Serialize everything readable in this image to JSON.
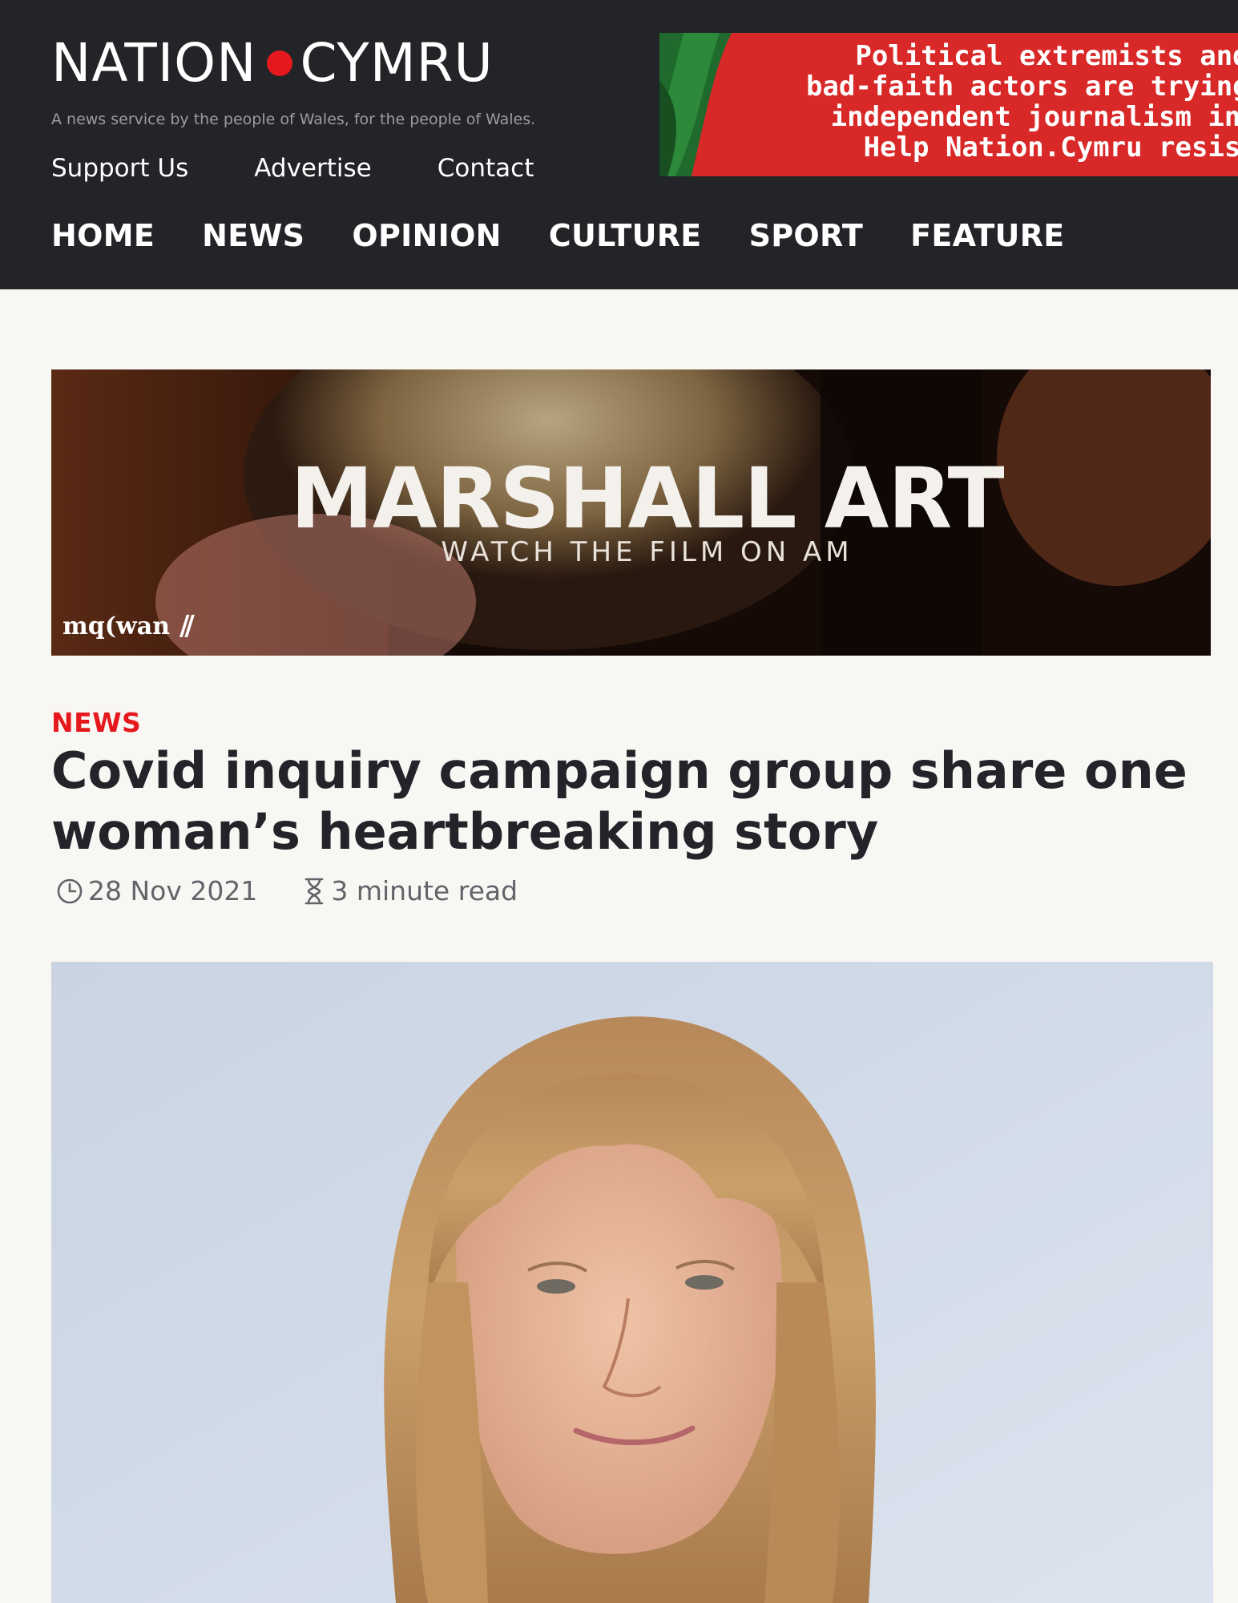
{
  "header": {
    "logo_left": "NATION",
    "logo_right": "CYMRU",
    "tagline": "A news service by the people of Wales, for the people of Wales.",
    "top_links": [
      "Support Us",
      "Advertise",
      "Contact"
    ],
    "nav": [
      "HOME",
      "NEWS",
      "OPINION",
      "CULTURE",
      "SPORT",
      "FEATURE"
    ],
    "promo_lines": [
      "Political extremists and",
      "bad-faith actors are trying to",
      "independent journalism in W",
      "Help Nation.Cymru resis"
    ]
  },
  "ad": {
    "title": "MARSHALL ART",
    "subtitle": "WATCH THE FILM ON AM",
    "brand": "mq(wan"
  },
  "article": {
    "category": "NEWS",
    "headline": "Covid inquiry campaign group share one woman’s heartbreaking story",
    "date": "28 Nov 2021",
    "read_time": "3 minute read"
  },
  "icons": {
    "date": "clock-icon",
    "read_time": "hourglass-icon"
  },
  "colors": {
    "header_bg": "#222428",
    "accent_red": "#e5191d",
    "page_bg": "#f9f7f3",
    "text": "#222429"
  }
}
